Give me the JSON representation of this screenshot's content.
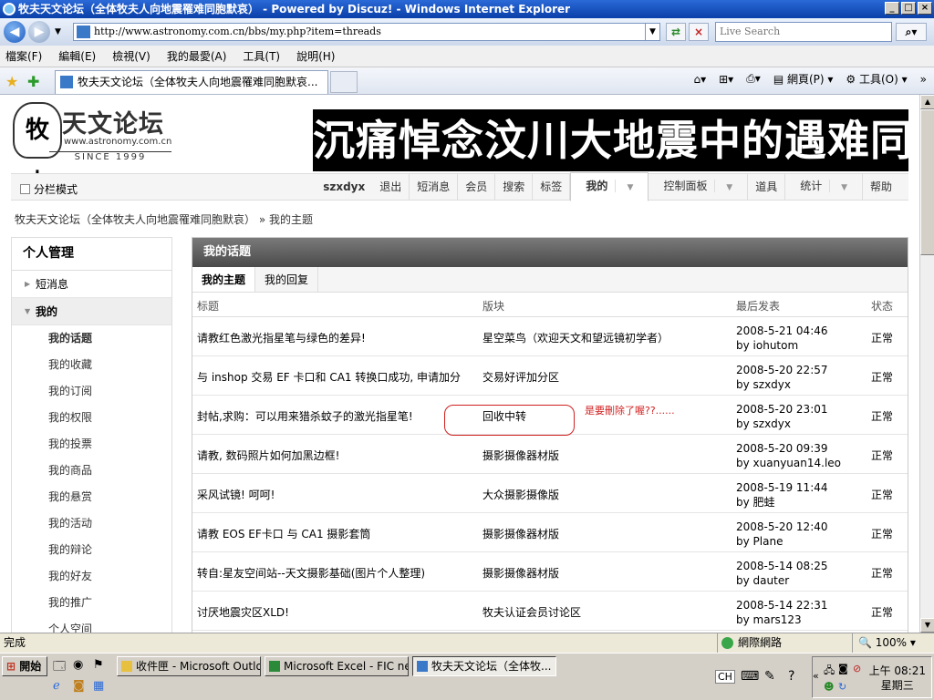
{
  "window": {
    "title": "牧夫天文论坛（全体牧夫人向地震罹难同胞默哀） - Powered by Discuz! - Windows Internet Explorer"
  },
  "address": {
    "url": "http://www.astronomy.com.cn/bbs/my.php?item=threads",
    "search_placeholder": "Live Search"
  },
  "menu": [
    "檔案(F)",
    "編輯(E)",
    "檢視(V)",
    "我的最愛(A)",
    "工具(T)",
    "說明(H)"
  ],
  "tab": {
    "label": "牧夫天文论坛（全体牧夫人向地震罹难同胞默哀..."
  },
  "cmd": {
    "page": "網頁(P)",
    "tools": "工具(O)"
  },
  "logo": {
    "name": "天文论坛",
    "mark": "牧夫",
    "url": "www.astronomy.com.cn",
    "since": "SINCE 1999"
  },
  "banner": "沉痛悼念汶川大地震中的遇难同胞",
  "forumnav": {
    "split": "分栏模式",
    "user": "szxdyx",
    "links": [
      "退出",
      "短消息",
      "会员",
      "搜索",
      "标签",
      "我的",
      "控制面板",
      "道具",
      "统计",
      "帮助"
    ]
  },
  "breadcrumb": {
    "forum": "牧夫天文论坛（全体牧夫人向地震罹难同胞默哀）",
    "sep": "»",
    "page": "我的主题"
  },
  "sidebar": {
    "title": "个人管理",
    "sections": [
      "短消息",
      "我的"
    ],
    "items": [
      "我的话题",
      "我的收藏",
      "我的订阅",
      "我的权限",
      "我的投票",
      "我的商品",
      "我的悬赏",
      "我的活动",
      "我的辩论",
      "我的好友",
      "我的推广",
      "个人空间"
    ]
  },
  "main": {
    "title": "我的话题",
    "tabs": [
      "我的主题",
      "我的回复"
    ],
    "columns": [
      "标题",
      "版块",
      "最后发表",
      "状态"
    ],
    "rows": [
      {
        "title": "请教红色激光指星笔与绿色的差异!",
        "board": "星空菜鸟（欢迎天文和望远镜初学者）",
        "date": "2008-5-21 04:46",
        "by": "by iohutom",
        "status": "正常"
      },
      {
        "title": "与 inshop 交易 EF 卡口和 CA1 转换口成功, 申请加分",
        "board": "交易好评加分区",
        "date": "2008-5-20 22:57",
        "by": "by szxdyx",
        "status": "正常"
      },
      {
        "title": "封帖,求购：可以用来猎杀蚊子的激光指星笔!",
        "board": "回收中转",
        "date": "2008-5-20 23:01",
        "by": "by szxdyx",
        "status": "正常"
      },
      {
        "title": "请教, 数码照片如何加黑边框!",
        "board": "摄影摄像器材版",
        "date": "2008-5-20 09:39",
        "by": "by xuanyuan14.leo",
        "status": "正常"
      },
      {
        "title": "采风试镜! 呵呵!",
        "board": "大众摄影摄像版",
        "date": "2008-5-19 11:44",
        "by": "by 肥蛙",
        "status": "正常"
      },
      {
        "title": "请教 EOS EF卡口 与 CA1 摄影套筒",
        "board": "摄影摄像器材版",
        "date": "2008-5-20 12:40",
        "by": "by Plane",
        "status": "正常"
      },
      {
        "title": "转自:星友空间站--天文摄影基础(图片个人整理)",
        "board": "摄影摄像器材版",
        "date": "2008-5-14 08:25",
        "by": "by dauter",
        "status": "正常"
      },
      {
        "title": "讨厌地震灾区XLD!",
        "board": "牧夫认证会员讨论区",
        "date": "2008-5-14 22:31",
        "by": "by mars123",
        "status": "正常"
      }
    ],
    "annotation": "是要刪除了喔??......"
  },
  "status": {
    "text": "完成",
    "zone": "網際網路",
    "zoom": "100%"
  },
  "taskbar": {
    "start": "開始",
    "tasks": [
      "收件匣 - Microsoft Outlook",
      "Microsoft Excel - FIC net...",
      "牧夫天文论坛（全体牧..."
    ],
    "ime": "CH",
    "time": "上午 08:21",
    "day": "星期三"
  }
}
